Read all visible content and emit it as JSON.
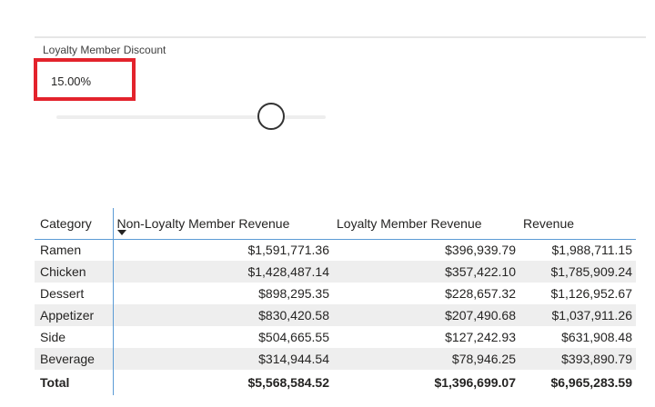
{
  "slicer": {
    "title": "Loyalty Member Discount",
    "value": "15.00%",
    "slider_fraction": 0.81,
    "highlight_color": "#e3232c"
  },
  "table": {
    "columns": [
      "Category",
      "Non-Loyalty Member Revenue",
      "Loyalty Member Revenue",
      "Revenue"
    ],
    "sort_icon": "sort-descending-icon",
    "rows": [
      [
        "Ramen",
        "$1,591,771.36",
        "$396,939.79",
        "$1,988,711.15"
      ],
      [
        "Chicken",
        "$1,428,487.14",
        "$357,422.10",
        "$1,785,909.24"
      ],
      [
        "Dessert",
        "$898,295.35",
        "$228,657.32",
        "$1,126,952.67"
      ],
      [
        "Appetizer",
        "$830,420.58",
        "$207,490.68",
        "$1,037,911.26"
      ],
      [
        "Side",
        "$504,665.55",
        "$127,242.93",
        "$631,908.48"
      ],
      [
        "Beverage",
        "$314,944.54",
        "$78,946.25",
        "$393,890.79"
      ]
    ],
    "total": [
      "Total",
      "$5,568,584.52",
      "$1,396,699.07",
      "$6,965,283.59"
    ],
    "accent_color": "#5b9bd5",
    "stripe_color": "#eeeeee"
  }
}
